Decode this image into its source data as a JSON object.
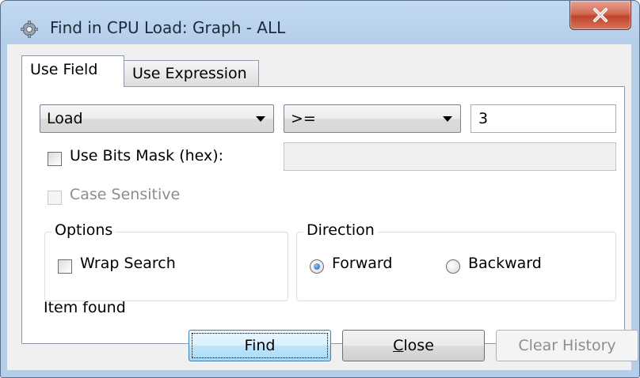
{
  "window": {
    "title": "Find in CPU Load: Graph - ALL",
    "icon": "gear-app-icon",
    "close_icon": "close-x-icon"
  },
  "tabs": [
    {
      "label": "Use Field",
      "active": true
    },
    {
      "label": "Use Expression",
      "active": false
    }
  ],
  "field": {
    "field_select": "Load",
    "operator_select": ">=",
    "value": "3"
  },
  "bits_mask": {
    "label": "Use Bits Mask (hex):",
    "checked": false,
    "value": ""
  },
  "case_sensitive": {
    "label": "Case Sensitive",
    "checked": false,
    "enabled": false
  },
  "options": {
    "title": "Options",
    "wrap_search_label": "Wrap Search",
    "wrap_search_checked": false
  },
  "direction": {
    "title": "Direction",
    "forward_label": "Forward",
    "backward_label": "Backward",
    "selected": "Forward"
  },
  "status": "Item found",
  "buttons": {
    "find": "Find",
    "close_first": "C",
    "close_rest": "lose",
    "clear_history": "Clear History"
  },
  "colors": {
    "title_bar": "#b4cde8",
    "close_button": "#c0432b",
    "default_button": "#bee6fd",
    "radio_dot": "#1f5fa8"
  }
}
